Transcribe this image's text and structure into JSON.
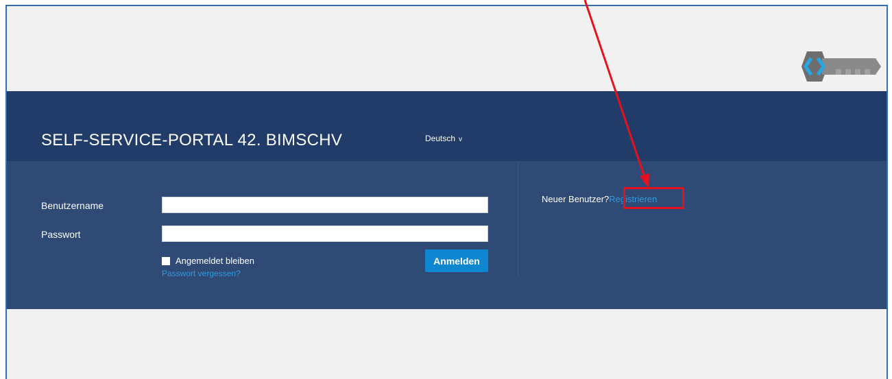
{
  "header": {
    "title": "SELF-SERVICE-PORTAL 42. BIMSCHV",
    "language": "Deutsch",
    "language_caret": "v"
  },
  "login": {
    "username_label": "Benutzername",
    "username_value": "",
    "password_label": "Passwort",
    "password_value": "",
    "remember_label": "Angemeldet bleiben",
    "forgot_link": "Passwort vergessen?",
    "submit_label": "Anmelden"
  },
  "registration": {
    "prompt": "Neuer Benutzer?",
    "link": "Registrieren"
  },
  "colors": {
    "header_band": "#213c68",
    "login_band": "#2f4a75",
    "accent_button": "#0f87d0",
    "link": "#2e9be0",
    "highlight": "#e8101c",
    "frame_border": "#2f6fb2",
    "page_bg": "#f1f1f1"
  },
  "icons": {
    "logo": "key-logo-icon",
    "checkbox": "checkbox-icon",
    "caret": "chevron-down-icon"
  }
}
